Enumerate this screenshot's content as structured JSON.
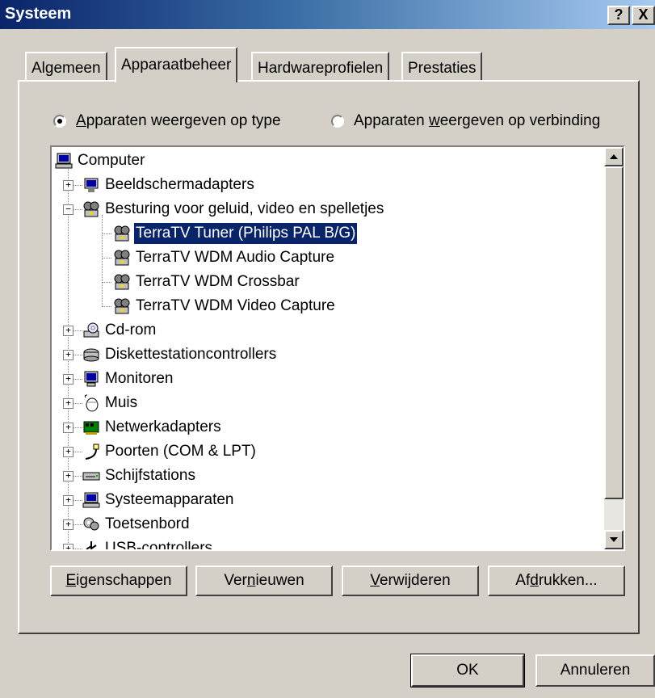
{
  "window": {
    "title": "Systeem",
    "help_glyph": "?",
    "close_glyph": "X"
  },
  "tabs": [
    {
      "label": "Algemeen"
    },
    {
      "label": "Apparaatbeheer",
      "active": true
    },
    {
      "label": "Hardwareprofielen"
    },
    {
      "label": "Prestaties"
    }
  ],
  "view_options": {
    "by_type": {
      "mnemonic": "A",
      "rest": "pparaten weergeven op type",
      "checked": true
    },
    "by_connection": {
      "pre": "Apparaten ",
      "mnemonic": "w",
      "rest": "eergeven op verbinding",
      "checked": false
    }
  },
  "tree": {
    "root": {
      "label": "Computer",
      "icon": "computer-icon"
    },
    "items": [
      {
        "label": "Beeldschermadapters",
        "icon": "display-adapter-icon",
        "expander": "+"
      },
      {
        "label": "Besturing voor geluid, video en spelletjes",
        "icon": "sound-video-game-icon",
        "expander": "−"
      },
      {
        "label": "TerraTV Tuner (Philips PAL B/G)",
        "icon": "multimedia-device-icon",
        "selected": true
      },
      {
        "label": "TerraTV WDM Audio Capture",
        "icon": "multimedia-device-icon"
      },
      {
        "label": "TerraTV WDM Crossbar",
        "icon": "multimedia-device-icon"
      },
      {
        "label": "TerraTV WDM Video Capture",
        "icon": "multimedia-device-icon"
      },
      {
        "label": "Cd-rom",
        "icon": "cdrom-icon",
        "expander": "+"
      },
      {
        "label": "Diskettestationcontrollers",
        "icon": "floppy-controller-icon",
        "expander": "+"
      },
      {
        "label": "Monitoren",
        "icon": "monitor-icon",
        "expander": "+"
      },
      {
        "label": "Muis",
        "icon": "mouse-icon",
        "expander": "+"
      },
      {
        "label": "Netwerkadapters",
        "icon": "network-adapter-icon",
        "expander": "+"
      },
      {
        "label": "Poorten (COM & LPT)",
        "icon": "port-icon",
        "expander": "+"
      },
      {
        "label": "Schijfstations",
        "icon": "disk-drive-icon",
        "expander": "+"
      },
      {
        "label": "Systeemapparaten",
        "icon": "system-device-icon",
        "expander": "+"
      },
      {
        "label": "Toetsenbord",
        "icon": "keyboard-icon",
        "expander": "+"
      },
      {
        "label": "USB-controllers",
        "icon": "usb-icon",
        "expander": "+"
      }
    ]
  },
  "buttons": {
    "properties": {
      "mnemonic": "E",
      "rest": "igenschappen"
    },
    "refresh": {
      "pre": "Ver",
      "mnemonic": "n",
      "rest": "ieuwen"
    },
    "remove": {
      "mnemonic": "V",
      "rest": "erwijderen"
    },
    "print": {
      "pre": "Af",
      "mnemonic": "d",
      "rest": "rukken..."
    },
    "ok": "OK",
    "cancel": "Annuleren"
  },
  "colors": {
    "face": "#d4d0c8",
    "title_start": "#0a246a",
    "title_end": "#a6caf0",
    "selection": "#0a246a"
  }
}
